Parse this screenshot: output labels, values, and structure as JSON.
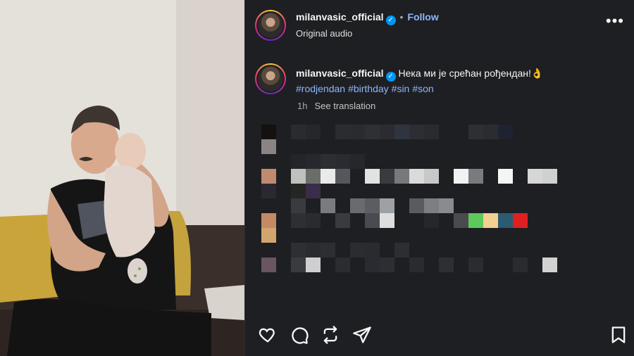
{
  "post": {
    "username": "milanvasic_official",
    "follow_label": "Follow",
    "subtitle": "Original audio",
    "caption_text": "Нека ми је срећан рођендан!👌",
    "hashtags": [
      "#rodjendan",
      "#birthday",
      "#sin",
      "#son"
    ],
    "timestamp": "1h",
    "see_translation": "See translation"
  },
  "icons": {
    "verified": "verified-badge-icon",
    "more": "more-options-icon",
    "like": "heart-icon",
    "comment": "comment-icon",
    "share_repost": "repost-icon",
    "share": "send-icon",
    "save": "bookmark-icon"
  },
  "colors": {
    "panel_bg": "#1e1f22",
    "link": "#8fb6ff",
    "verified": "#0095f6"
  }
}
